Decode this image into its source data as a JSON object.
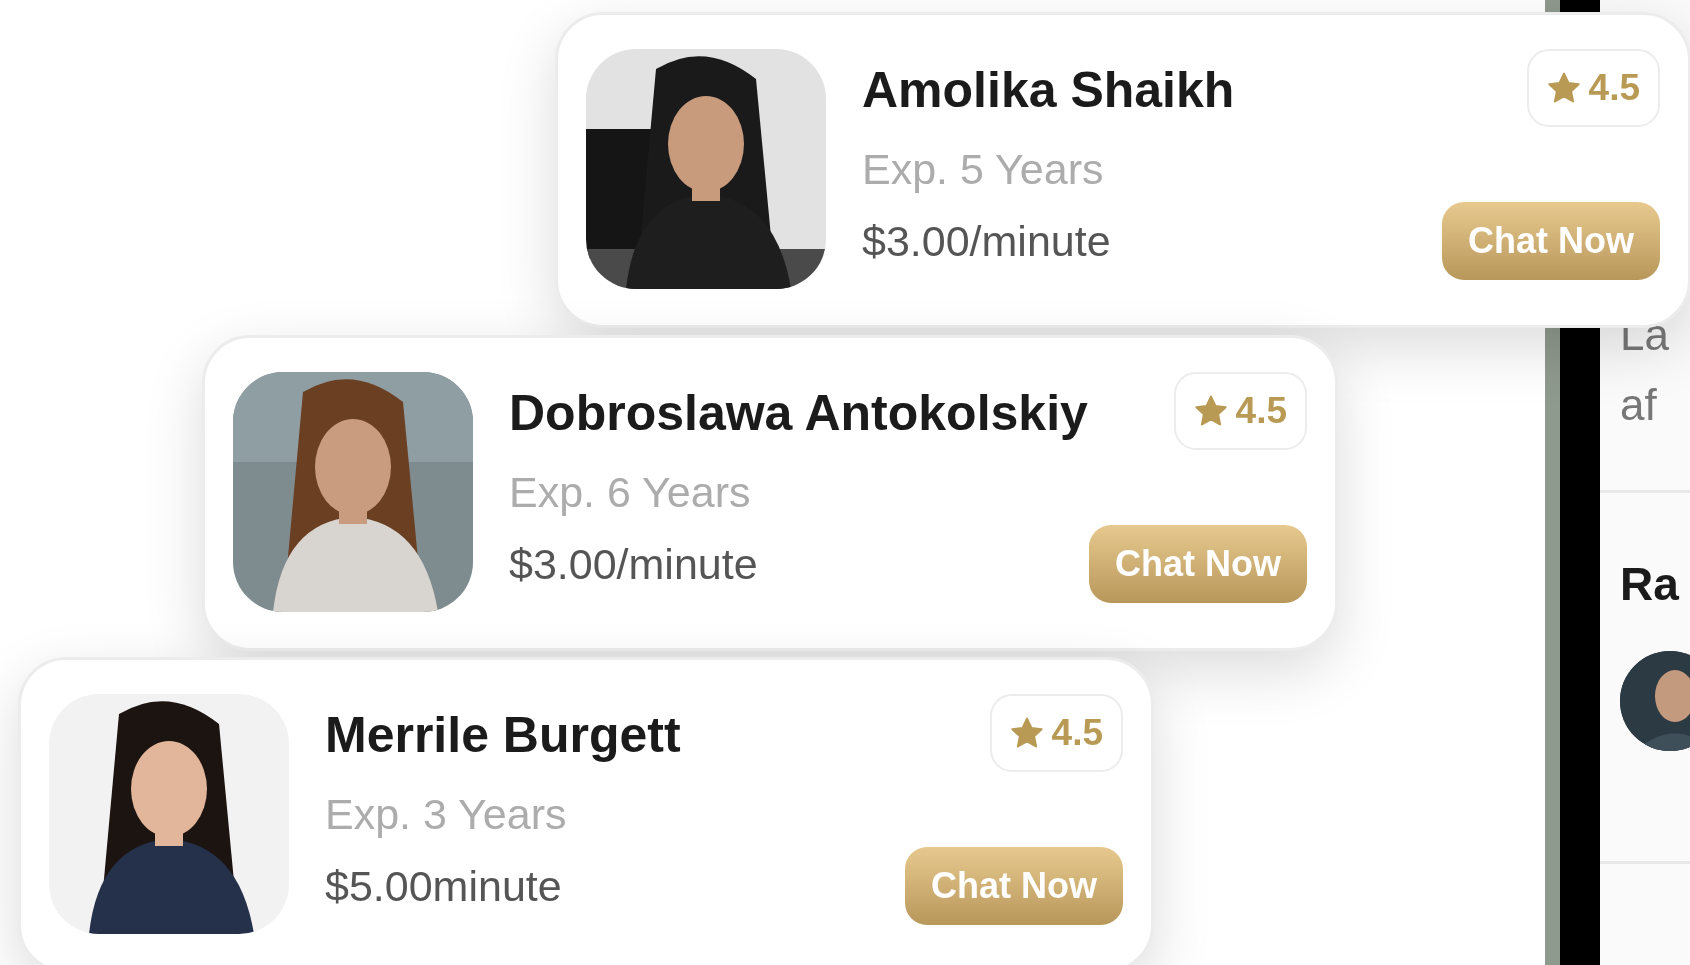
{
  "experts": [
    {
      "name": "Amolika Shaikh",
      "experience": "Exp. 5 Years",
      "price": "$3.00/minute",
      "rating": "4.5",
      "button": "Chat Now"
    },
    {
      "name": "Dobroslawa Antokolskiy",
      "experience": "Exp. 6 Years",
      "price": "$3.00/minute",
      "rating": "4.5",
      "button": "Chat Now"
    },
    {
      "name": "Merrile Burgett",
      "experience": "Exp. 3 Years",
      "price": "$5.00minute",
      "rating": "4.5",
      "button": "Chat Now"
    }
  ],
  "phone_screen": {
    "text_lines": [
      "La",
      "af"
    ],
    "section_title": "Ra"
  }
}
